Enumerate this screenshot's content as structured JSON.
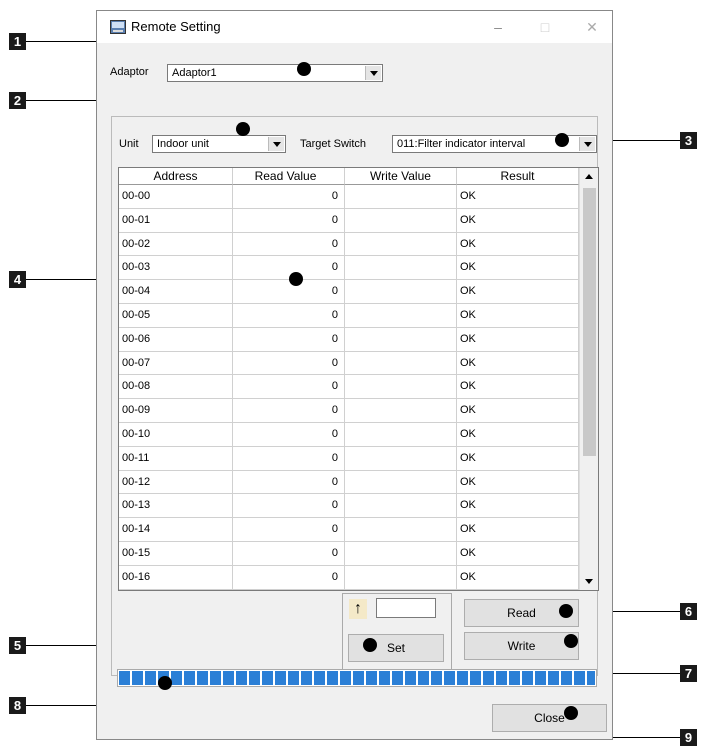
{
  "window": {
    "title": "Remote Setting",
    "controls": {
      "minimize": "–",
      "maximize": "□",
      "close": "✕"
    }
  },
  "adaptor": {
    "label": "Adaptor",
    "value": "Adaptor1"
  },
  "unit": {
    "label": "Unit",
    "value": "Indoor unit"
  },
  "target_switch": {
    "label": "Target Switch",
    "value": "011:Filter indicator interval"
  },
  "table": {
    "columns": [
      "Address",
      "Read Value",
      "Write Value",
      "Result"
    ],
    "rows": [
      [
        "00-00",
        "0",
        "",
        "OK"
      ],
      [
        "00-01",
        "0",
        "",
        "OK"
      ],
      [
        "00-02",
        "0",
        "",
        "OK"
      ],
      [
        "00-03",
        "0",
        "",
        "OK"
      ],
      [
        "00-04",
        "0",
        "",
        "OK"
      ],
      [
        "00-05",
        "0",
        "",
        "OK"
      ],
      [
        "00-06",
        "0",
        "",
        "OK"
      ],
      [
        "00-07",
        "0",
        "",
        "OK"
      ],
      [
        "00-08",
        "0",
        "",
        "OK"
      ],
      [
        "00-09",
        "0",
        "",
        "OK"
      ],
      [
        "00-10",
        "0",
        "",
        "OK"
      ],
      [
        "00-11",
        "0",
        "",
        "OK"
      ],
      [
        "00-12",
        "0",
        "",
        "OK"
      ],
      [
        "00-13",
        "0",
        "",
        "OK"
      ],
      [
        "00-14",
        "0",
        "",
        "OK"
      ],
      [
        "00-15",
        "0",
        "",
        "OK"
      ],
      [
        "00-16",
        "0",
        "",
        "OK"
      ]
    ]
  },
  "set_panel": {
    "arrow": "↑",
    "input_value": "",
    "set_label": "Set"
  },
  "buttons": {
    "read": "Read",
    "write": "Write",
    "close": "Close"
  },
  "progress": {
    "fraction": 1.0,
    "color": "#2b7fd6"
  },
  "callouts": [
    "1",
    "2",
    "3",
    "4",
    "5",
    "6",
    "7",
    "8",
    "9"
  ]
}
